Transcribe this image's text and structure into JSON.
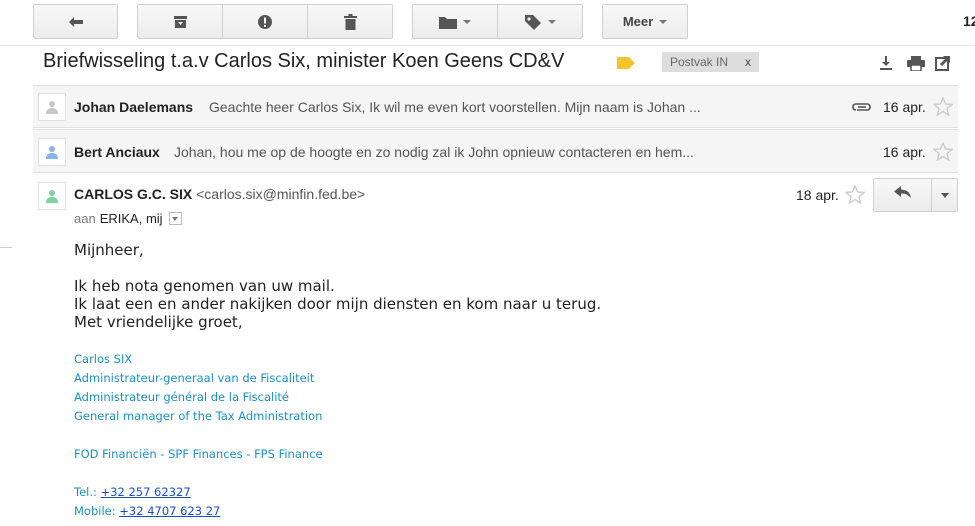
{
  "toolbar": {
    "back_icon": "back-arrow-icon",
    "archive_icon": "archive-icon",
    "spam_icon": "report-spam-icon",
    "delete_icon": "trash-icon",
    "move_icon": "folder-icon",
    "labels_icon": "label-icon",
    "more_label": "Meer",
    "page_count": "12"
  },
  "thread": {
    "subject": "Briefwisseling t.a.v Carlos Six, minister Koen Geens CD&V",
    "label_chip": "Postvak IN",
    "label_remove": "x",
    "label_color": "#f4c430"
  },
  "messages": [
    {
      "sender": "Johan Daelemans",
      "snippet": "Geachte heer Carlos Six, Ik wil me even kort voorstellen. Mijn naam is Johan ...",
      "date": "16 apr.",
      "has_attachment": true
    },
    {
      "sender": "Bert Anciaux",
      "snippet": "Johan, hou me op de hoogte en zo nodig zal ik John opnieuw contacteren en hem...",
      "date": "16 apr.",
      "has_attachment": false
    }
  ],
  "open_message": {
    "sender_name": "CARLOS G.C. SIX",
    "sender_email": "<carlos.six@minfin.fed.be>",
    "to_prefix": "aan",
    "to_names": "ERIKA, mij",
    "date": "18 apr.",
    "greeting": "Mijnheer,",
    "body": [
      "Ik heb nota genomen van uw mail.",
      "Ik laat een en ander nakijken door mijn diensten en kom naar u terug.",
      "Met vriendelijke groet,"
    ],
    "signature": {
      "name": "Carlos SIX",
      "title_nl": "Administrateur-generaal van de Fiscaliteit",
      "title_fr": "Administrateur général de la Fiscalité",
      "title_en": "General manager of the Tax Administration",
      "org": "FOD Financiën - SPF Finances - FPS Finance",
      "tel_label": "Tel.:",
      "tel": "+32 257 62327",
      "mobile_label": "Mobile:",
      "mobile": "+32 4707 623 27"
    }
  },
  "colors": {
    "avatar_grey": "#c8c8c8",
    "avatar_blue": "#8ab4e8",
    "avatar_green": "#7fd0a0",
    "signature_blue": "#1a8fbf"
  }
}
